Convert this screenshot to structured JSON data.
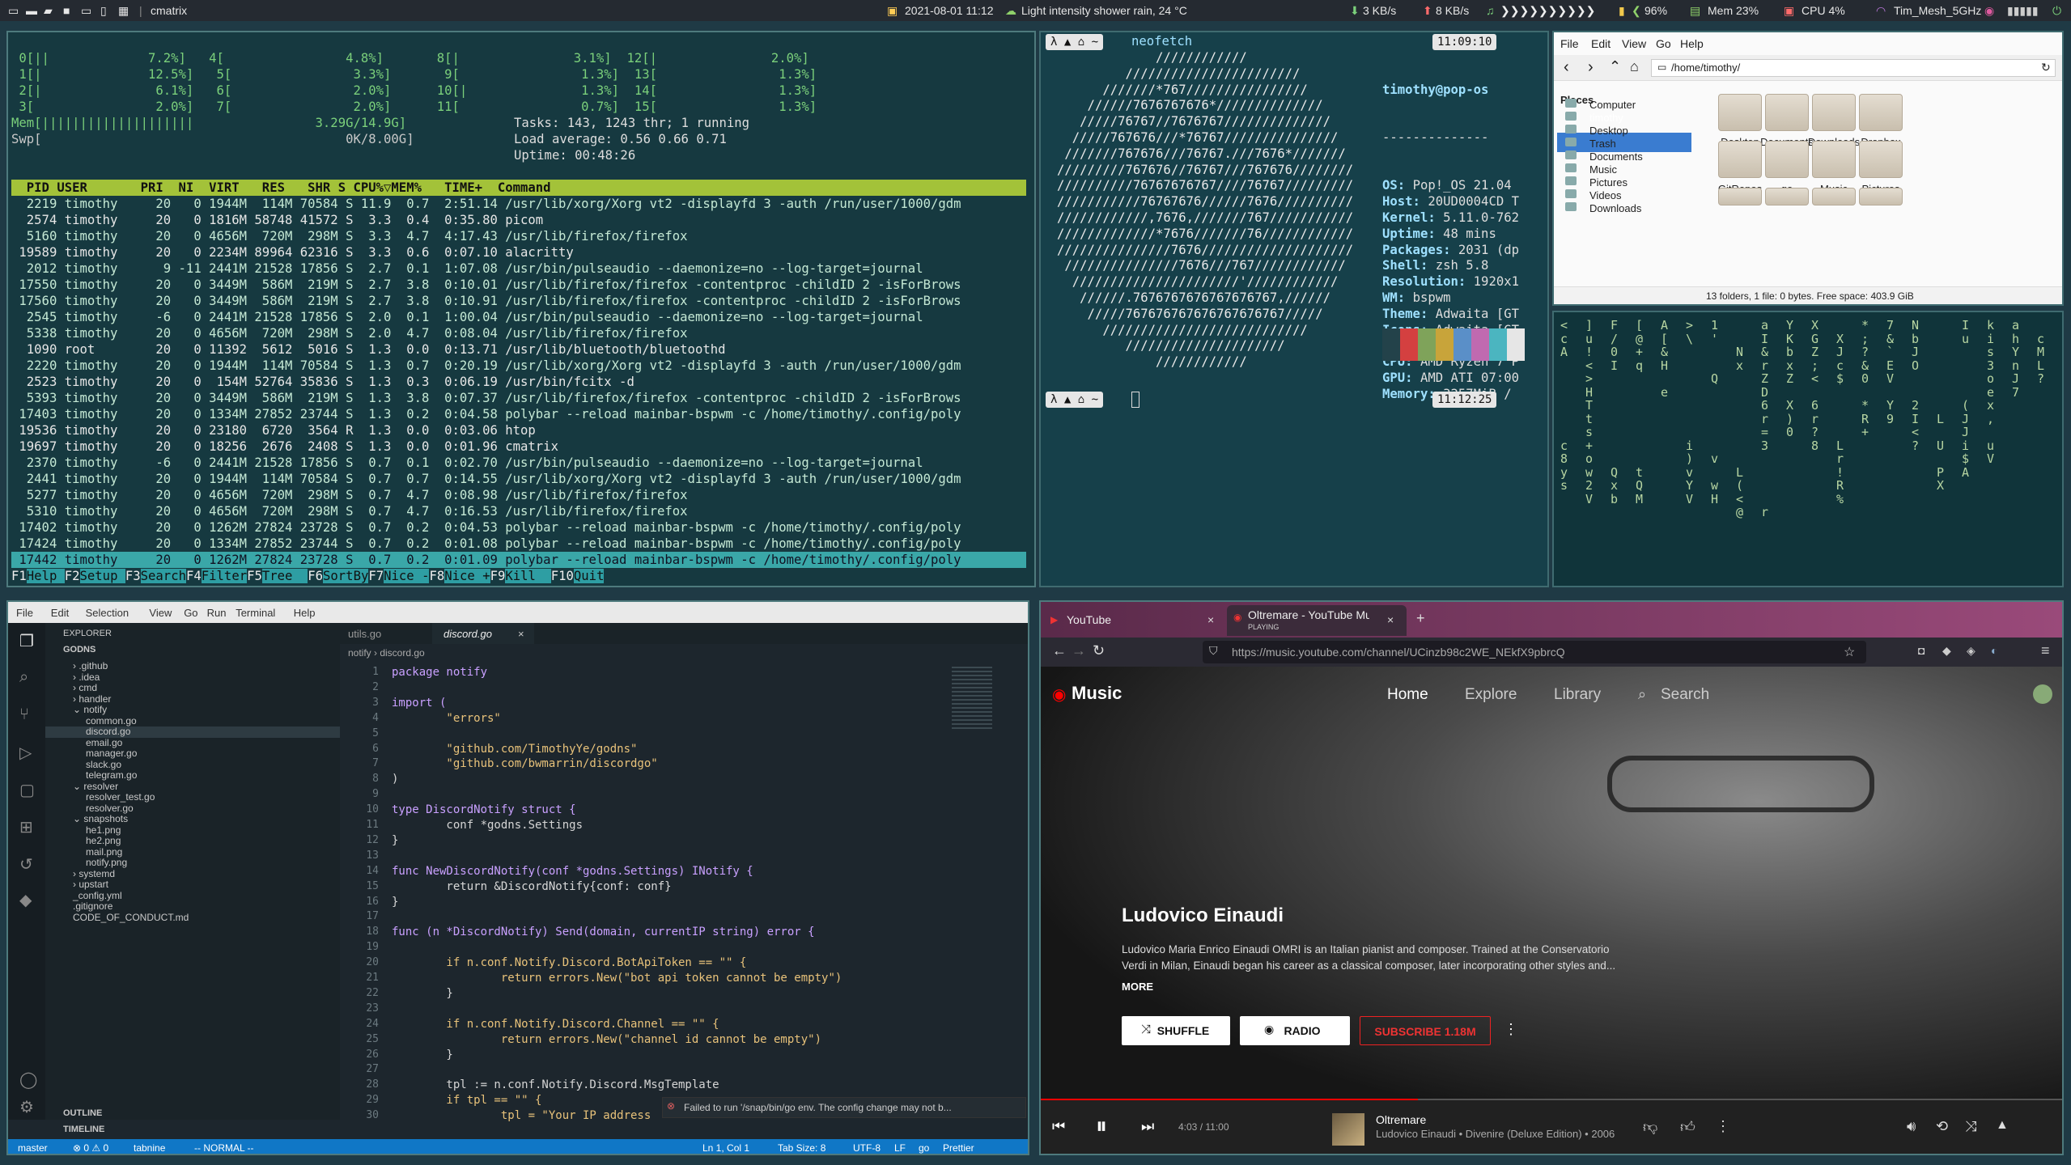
{
  "topbar": {
    "wm_title": "cmatrix",
    "datetime": "2021-08-01 11:12",
    "weather": "Light intensity shower rain, 24 °C",
    "down": "3 KB/s",
    "up": "8 KB/s",
    "music_bar": "❯❯❯❯❯❯❯❯❯❯",
    "battery": "96%",
    "mem": "Mem 23%",
    "cpu": "CPU  4%",
    "wifi": "Tim_Mesh_5GHz"
  },
  "htop": {
    "cpu_lines": [
      " 0[||             7.2%]   4[                4.8%]       8[|               3.1%]  12[|               2.0%]",
      " 1[|              12.5%]   5[                3.3%]       9[                1.3%]  13[                1.3%]",
      " 2[|               6.1%]   6[                2.0%]      10[|               1.3%]  14[                1.3%]",
      " 3[                2.0%]   7[                2.0%]      11[                0.7%]  15[                1.3%]"
    ],
    "mem_line": "Mem[||||||||||||||||||||                3.29G/14.9G]",
    "swp_line": "Swp[                                        0K/8.00G]",
    "tasks": "Tasks: 143, 1243 thr; 1 running",
    "load": "Load average: 0.56 0.66 0.71",
    "uptime": "Uptime: 00:48:26",
    "header": "  PID USER       PRI  NI  VIRT   RES   SHR S CPU%▽MEM%   TIME+  Command                                             ",
    "rows": [
      "  2219 timothy     20   0 1944M  114M 70584 S 11.9  0.7  2:51.14 /usr/lib/xorg/Xorg vt2 -displayfd 3 -auth /run/user/1000/gdm",
      "  2574 timothy     20   0 1816M 58748 41572 S  3.3  0.4  0:35.80 picom",
      "  5160 timothy     20   0 4656M  720M  298M S  3.3  4.7  4:17.43 /usr/lib/firefox/firefox",
      " 19589 timothy     20   0 2234M 89964 62316 S  3.3  0.6  0:07.10 alacritty",
      "  2012 timothy      9 -11 2441M 21528 17856 S  2.7  0.1  1:07.08 /usr/bin/pulseaudio --daemonize=no --log-target=journal",
      " 17550 timothy     20   0 3449M  586M  219M S  2.7  3.8  0:10.01 /usr/lib/firefox/firefox -contentproc -childID 2 -isForBrows",
      " 17560 timothy     20   0 3449M  586M  219M S  2.7  3.8  0:10.91 /usr/lib/firefox/firefox -contentproc -childID 2 -isForBrows",
      "  2545 timothy     -6   0 2441M 21528 17856 S  2.0  0.1  1:00.04 /usr/bin/pulseaudio --daemonize=no --log-target=journal",
      "  5338 timothy     20   0 4656M  720M  298M S  2.0  4.7  0:08.04 /usr/lib/firefox/firefox",
      "  1090 root        20   0 11392  5612  5016 S  1.3  0.0  0:13.71 /usr/lib/bluetooth/bluetoothd",
      "  2220 timothy     20   0 1944M  114M 70584 S  1.3  0.7  0:20.19 /usr/lib/xorg/Xorg vt2 -displayfd 3 -auth /run/user/1000/gdm",
      "  2523 timothy     20   0  154M 52764 35836 S  1.3  0.3  0:06.19 /usr/bin/fcitx -d",
      "  5393 timothy     20   0 3449M  586M  219M S  1.3  3.8  0:07.37 /usr/lib/firefox/firefox -contentproc -childID 2 -isForBrows",
      " 17403 timothy     20   0 1334M 27852 23744 S  1.3  0.2  0:04.58 polybar --reload mainbar-bspwm -c /home/timothy/.config/poly",
      " 19536 timothy     20   0 23180  6720  3564 R  1.3  0.0  0:03.06 htop",
      " 19697 timothy     20   0 18256  2676  2408 S  1.3  0.0  0:01.96 cmatrix",
      "  2370 timothy     -6   0 2441M 21528 17856 S  0.7  0.1  0:02.70 /usr/bin/pulseaudio --daemonize=no --log-target=journal",
      "  2441 timothy     20   0 1944M  114M 70584 S  0.7  0.7  0:14.55 /usr/lib/xorg/Xorg vt2 -displayfd 3 -auth /run/user/1000/gdm",
      "  5277 timothy     20   0 4656M  720M  298M S  0.7  4.7  0:08.98 /usr/lib/firefox/firefox",
      "  5310 timothy     20   0 4656M  720M  298M S  0.7  4.7  0:16.53 /usr/lib/firefox/firefox",
      " 17402 timothy     20   0 1262M 27824 23728 S  0.7  0.2  0:04.53 polybar --reload mainbar-bspwm -c /home/timothy/.config/poly",
      " 17424 timothy     20   0 1334M 27852 23744 S  0.7  0.2  0:01.08 polybar --reload mainbar-bspwm -c /home/timothy/.config/poly",
      " 17442 timothy     20   0 1262M 27824 23728 S  0.7  0.2  0:01.09 polybar --reload mainbar-bspwm -c /home/timothy/.config/poly"
    ],
    "fkeys": [
      "F1",
      "Help ",
      "F2",
      "Setup ",
      "F3",
      "Search",
      "F4",
      "Filter",
      "F5",
      "Tree  ",
      "F6",
      "SortBy",
      "F7",
      "Nice -",
      "F8",
      "Nice +",
      "F9",
      "Kill  ",
      "F10",
      "Quit"
    ]
  },
  "neofetch": {
    "cmd": "neofetch",
    "time1": "11:09:10",
    "time2": "11:12:25",
    "art": "             ////////////\n         ///////////////////////\n      ///////*767////////////////\n    //////7676767676*//////////////\n   /////76767//7676767//////////////\n  /////767676///*76767///////////////\n ///////767676///76767.///7676*///////\n/////////767676//76767///767676////////\n//////////76767676767////76767/////////\n///////////76767676//////7676//////////\n////////////,7676,///////767///////////\n/////////////*7676///////76////////////\n///////////////7676////////////////////\n ///////////////7676///767////////////\n  //////////////////////'////////////\n   //////.7676767676767676767,//////\n    /////767676767676767676767/////\n      ///////////////////////////\n         /////////////////////\n             ////////////",
    "user": "timothy@pop-os",
    "sep": "--------------",
    "info": [
      [
        "OS: ",
        "Pop!_OS 21.04"
      ],
      [
        "Host: ",
        "20UD0004CD T"
      ],
      [
        "Kernel: ",
        "5.11.0-762"
      ],
      [
        "Uptime: ",
        "48 mins"
      ],
      [
        "Packages: ",
        "2031 (dp"
      ],
      [
        "Shell: ",
        "zsh 5.8"
      ],
      [
        "Resolution: ",
        "1920x1"
      ],
      [
        "WM: ",
        "bspwm"
      ],
      [
        "Theme: ",
        "Adwaita [GT"
      ],
      [
        "Icons: ",
        "Adwaita [GT"
      ],
      [
        "Terminal: ",
        "alacritt"
      ],
      [
        "CPU: ",
        "AMD Ryzen 7 P"
      ],
      [
        "GPU: ",
        "AMD ATI 07:00"
      ],
      [
        "Memory: ",
        "3257MiB /"
      ]
    ],
    "palette": [
      "#23424a",
      "#d44040",
      "#7fa35a",
      "#c8a43a",
      "#5a8fc8",
      "#c06ab0",
      "#4bb5c0",
      "#e6e6e6"
    ]
  },
  "files": {
    "menu": [
      "File",
      "Edit",
      "View",
      "Go",
      "Help"
    ],
    "path": "/home/timothy/",
    "places_title": "Places",
    "places": [
      "Computer",
      "timothy",
      "Desktop",
      "Trash",
      "Documents",
      "Music",
      "Pictures",
      "Videos",
      "Downloads"
    ],
    "items": [
      "Desktop",
      "Documents",
      "Downloads",
      "Dropbox",
      "GitRepos",
      "go",
      "Music",
      "Pictures"
    ],
    "status": "13 folders, 1 file: 0 bytes. Free space: 403.9 GiB"
  },
  "matrix": {
    "cols": [
      "<\nc\nA\n\n\n\n\n\n\nc\n8\ny\ns",
      "]\nu\n!\n<\n>\nH\nT\nt\ns\n+\no\nw\n2\nV",
      "F\n/\n0\nI\n\n\n\n\n\n\n\nQ\nx\nb",
      "[\n@\n+\nq\n\n\n\n\n\n\n\nt\nQ\nM",
      "A\n[\n&\nH\n\ne",
      ">\n\\\n\n\n\n\n\n\n\ni\n)\nv\nY\nV",
      "1\n'\n\n\nQ\n\n\n\n\n\nv\n\nw\nH",
      "\n\nN\nx\n\n\n\n\n\n\n\nL\n(\n<\n@",
      "a\nI\n&\nr\nZ\nD\n6\nr\n=\n3\n\n\n\n\nr",
      "Y\nK\nb\nx\nZ\n\nX\n)\n0",
      "X\nG\nZ\n;\n<\n\n6\nr\n?\n8",
      "\nX\nJ\nc\n$\n\n\n\n\nL\nr\n!\nR\n%",
      "*\n;\n?\n&\n0\n\n*\nR\n+",
      "7\n&\n`\nE\nV\n\nY\n9",
      "N\nb\nJ\nO\n\n\n2\nI\n<\n?\n\n\n\n\n\n\n",
      "\n\n\n\n\n\n\nL\n\nU\n\nP\nX",
      "I\nu\n\n\n\n\n(\nJ\nJ\ni\n$\nA",
      "k\ni\ns\n3\no\ne\nx\n,\n\nu\nV",
      "a\nh\nY\nn\nJ\n7",
      "\nc\nM\nL\n?"
    ]
  },
  "vscode": {
    "menu": [
      "File",
      "Edit",
      "Selection",
      "View",
      "Go",
      "Run",
      "Terminal",
      "Help"
    ],
    "explorer": "EXPLORER",
    "root": "GODNS",
    "tree": [
      [
        "› .github",
        1
      ],
      [
        "› .idea",
        1
      ],
      [
        "› cmd",
        1
      ],
      [
        "› handler",
        1
      ],
      [
        "⌄ notify",
        1
      ],
      [
        "common.go",
        2
      ],
      [
        "discord.go",
        2
      ],
      [
        "email.go",
        2
      ],
      [
        "manager.go",
        2
      ],
      [
        "slack.go",
        2
      ],
      [
        "telegram.go",
        2
      ],
      [
        "⌄ resolver",
        1
      ],
      [
        "resolver_test.go",
        2
      ],
      [
        "resolver.go",
        2
      ],
      [
        "⌄ snapshots",
        1
      ],
      [
        "he1.png",
        2
      ],
      [
        "he2.png",
        2
      ],
      [
        "mail.png",
        2
      ],
      [
        "notify.png",
        2
      ],
      [
        "› systemd",
        1
      ],
      [
        "› upstart",
        1
      ],
      [
        "_config.yml",
        1
      ],
      [
        ".gitignore",
        1
      ],
      [
        "CODE_OF_CONDUCT.md",
        1
      ]
    ],
    "outline": "OUTLINE",
    "timeline": "TIMELINE",
    "tab1": "utils.go",
    "tab2": "discord.go",
    "crumb": "notify › discord.go",
    "code": [
      "package notify",
      "",
      "import (",
      "        \"errors\"",
      "",
      "        \"github.com/TimothyYe/godns\"",
      "        \"github.com/bwmarrin/discordgo\"",
      ")",
      "",
      "type DiscordNotify struct {",
      "        conf *godns.Settings",
      "}",
      "",
      "func NewDiscordNotify(conf *godns.Settings) INotify {",
      "        return &DiscordNotify{conf: conf}",
      "}",
      "",
      "func (n *DiscordNotify) Send(domain, currentIP string) error {",
      "",
      "        if n.conf.Notify.Discord.BotApiToken == \"\" {",
      "                return errors.New(\"bot api token cannot be empty\")",
      "        }",
      "",
      "        if n.conf.Notify.Discord.Channel == \"\" {",
      "                return errors.New(\"channel id cannot be empty\")",
      "        }",
      "",
      "        tpl := n.conf.Notify.Discord.MsgTemplate",
      "        if tpl == \"\" {",
      "                tpl = \"Your IP address"
    ],
    "toast": "Failed to run '/snap/bin/go env. The config change may not b...",
    "status_left": [
      "master",
      "⊗ 0 ⚠ 0",
      "tabnine",
      "-- NORMAL --"
    ],
    "status_right": [
      "Ln 1, Col 1",
      "Tab Size: 8",
      "UTF-8",
      "LF",
      "go",
      "Prettier"
    ]
  },
  "ytm": {
    "tab1": "YouTube",
    "tab2": "Oltremare - YouTube Mus",
    "tab2_sub": "PLAYING",
    "url": "https://music.youtube.com/channel/UCinzb98c2WE_NEkfX9pbrcQ",
    "logo": "Music",
    "nav": [
      "Home",
      "Explore",
      "Library",
      "Search"
    ],
    "artist": "Ludovico Einaudi",
    "bio1": "Ludovico Maria Enrico Einaudi OMRI is an Italian pianist and composer. Trained at the Conservatorio",
    "bio2": "Verdi in Milan, Einaudi began his career as a classical composer, later incorporating other styles and...",
    "more": "MORE",
    "shuffle": "SHUFFLE",
    "radio": "RADIO",
    "subscribe": "SUBSCRIBE  1.18M",
    "time": "4:03 / 11:00",
    "track": "Oltremare",
    "track_sub": "Ludovico Einaudi • Divenire (Deluxe Edition) • 2006",
    "progress": 0.368
  }
}
